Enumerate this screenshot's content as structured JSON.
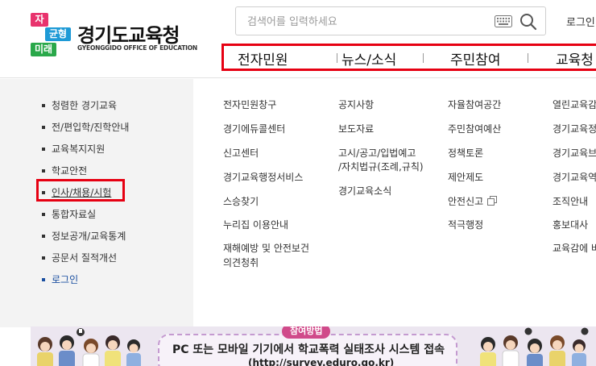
{
  "logo": {
    "boxes": [
      "자율",
      "균형",
      "미래"
    ],
    "title": "경기도교육청",
    "subtitle": "GYEONGGIDO OFFICE OF EDUCATION",
    "colors": {
      "pink": "#e8336d",
      "blue": "#1e9ad6",
      "green": "#2aa84a"
    }
  },
  "search": {
    "placeholder": "검색어를 입력하세요",
    "keyboard_icon": "keyboard-icon",
    "search_icon": "magnifier-icon"
  },
  "top_login": "로그인",
  "gnb": [
    "전자민원",
    "뉴스/소식",
    "주민참여",
    "교육청"
  ],
  "highlight_color": "#e60012",
  "left_nav": [
    "청렴한 경기교육",
    "전/편입학/진학안내",
    "교육복지지원",
    "학교안전",
    "인사/채용/시험",
    "통합자료실",
    "정보공개/교육통계",
    "공문서 질적개선",
    "로그인"
  ],
  "columns": {
    "col1": [
      "전자민원창구",
      "경기에듀콜센터",
      "신고센터",
      "경기교육행정서비스",
      "스승찾기",
      "누리집 이용안내",
      "재해예방 및 안전보건",
      "의견청취"
    ],
    "col2": [
      "공지사항",
      "보도자료",
      "고시/공고/입법예고",
      "/자치법규(조례,규칙)",
      "경기교육소식"
    ],
    "col3": [
      "자율참여공간",
      "주민참여예산",
      "정책토론",
      "제안제도",
      "안전신고",
      "적극행정"
    ],
    "col4": [
      "열린교육감",
      "경기교육정",
      "경기교육브",
      "경기교육역",
      "조직안내",
      "홍보대사",
      "교육감에 바"
    ]
  },
  "banner": {
    "badge": "참여방법",
    "title": "PC 또는 모바일 기기에서 학교폭력 실태조사 시스템 접속",
    "url": "(http://survey.eduro.go.kr)"
  }
}
